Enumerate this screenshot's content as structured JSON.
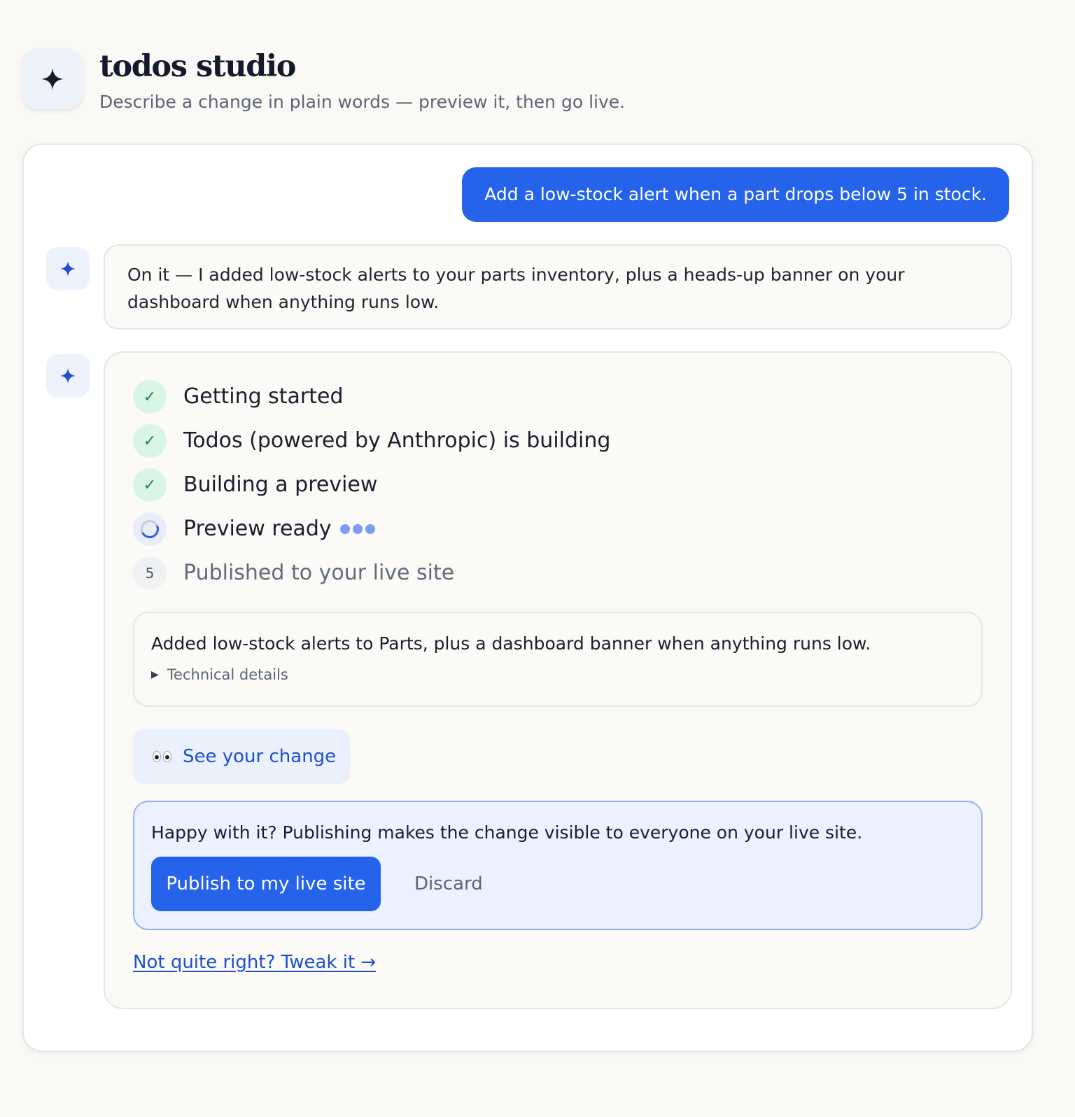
{
  "header": {
    "title": "todos studio",
    "subtitle": "Describe a change in plain words — preview it, then go live.",
    "logo_icon": "sparkle-icon"
  },
  "conversation": {
    "user_message": "Add a low-stock alert when a part drops below 5 in stock.",
    "assistant_message": "On it — I added low-stock alerts to your parts inventory, plus a heads-up banner on your dashboard when anything runs low.",
    "steps": [
      {
        "label": "Getting started",
        "status": "done",
        "icon": "check-icon"
      },
      {
        "label": "Todos (powered by Anthropic) is building",
        "status": "done",
        "icon": "check-icon"
      },
      {
        "label": "Building a preview",
        "status": "done",
        "icon": "check-icon"
      },
      {
        "label": "Preview ready",
        "status": "in-progress",
        "icon": "spinner-icon"
      },
      {
        "label": "Published to your live site",
        "status": "pending",
        "number": "5"
      }
    ],
    "summary": {
      "text": "Added low-stock alerts to Parts, plus a dashboard banner when anything runs low.",
      "details_toggle": "Technical details"
    },
    "see_change_label": "See your change",
    "publish": {
      "prompt": "Happy with it? Publishing makes the change visible to everyone on your live site.",
      "publish_label": "Publish to my live site",
      "discard_label": "Discard"
    },
    "tweak_link": "Not quite right? Tweak it →"
  },
  "colors": {
    "accent": "#2563eb",
    "success_bg": "#d8f5e6",
    "success_fg": "#1d8a55",
    "background": "#faf9f6"
  }
}
